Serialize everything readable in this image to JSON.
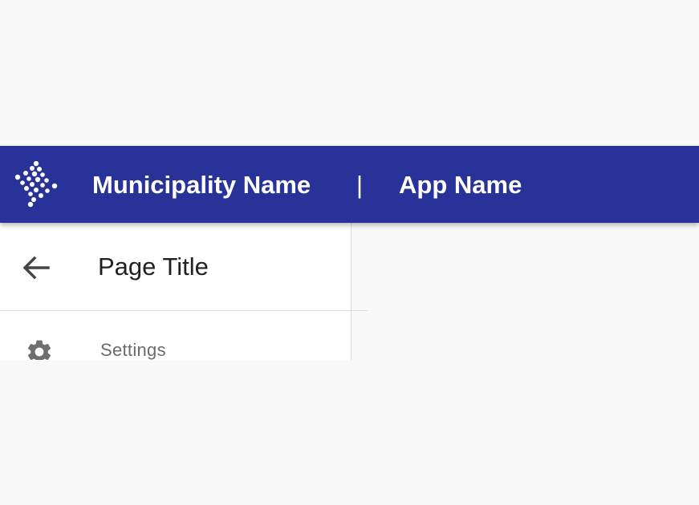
{
  "header": {
    "logo_icon": "dotted-diamond-logo-icon",
    "municipality_name": "Municipality Name",
    "separator": "|",
    "app_name": "App Name",
    "background_color": "#293298",
    "text_color": "#ffffff"
  },
  "drawer": {
    "back_icon": "arrow-left-icon",
    "page_title": "Page Title",
    "items": [
      {
        "icon": "gear-icon",
        "label": "Settings"
      }
    ]
  },
  "page": {
    "background_color": "#f9f9f9"
  }
}
